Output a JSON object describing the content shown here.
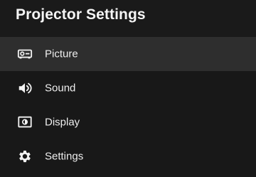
{
  "header": {
    "title": "Projector Settings"
  },
  "menu": {
    "selected_index": 0,
    "items": [
      {
        "label": "Picture",
        "icon": "projector-icon"
      },
      {
        "label": "Sound",
        "icon": "speaker-volume-icon"
      },
      {
        "label": "Display",
        "icon": "display-brightness-icon"
      },
      {
        "label": "Settings",
        "icon": "gear-icon"
      }
    ]
  },
  "colors": {
    "background": "#181818",
    "selected_row": "#2e2e2e",
    "text": "#f2f2f2"
  }
}
